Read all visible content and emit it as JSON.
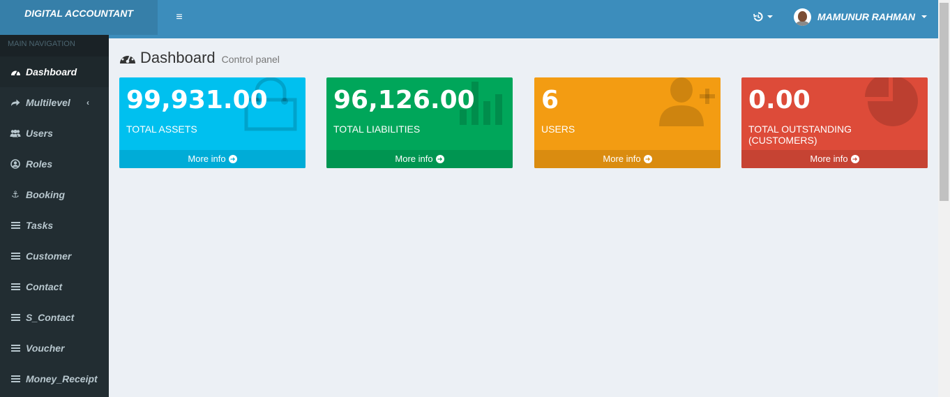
{
  "app": {
    "title": "DIGITAL ACCOUNTANT"
  },
  "header": {
    "menu_icon": "hamburger-icon",
    "history_icon": "history-icon",
    "user_name": "MAMUNUR RAHMAN"
  },
  "sidebar": {
    "header": "MAIN NAVIGATION",
    "items": [
      {
        "label": "Dashboard",
        "icon": "dashboard-icon",
        "active": true
      },
      {
        "label": "Multilevel",
        "icon": "share-icon"
      },
      {
        "label": "Users",
        "icon": "users-icon"
      },
      {
        "label": "Roles",
        "icon": "user-circle-icon"
      },
      {
        "label": "Booking",
        "icon": "anchor-icon"
      },
      {
        "label": "Tasks",
        "icon": "list-icon"
      },
      {
        "label": "Customer",
        "icon": "list-icon"
      },
      {
        "label": "Contact",
        "icon": "list-icon"
      },
      {
        "label": "S_Contact",
        "icon": "list-icon"
      },
      {
        "label": "Voucher",
        "icon": "list-icon"
      },
      {
        "label": "Money_Receipt",
        "icon": "list-icon"
      }
    ]
  },
  "page": {
    "title": "Dashboard",
    "subtitle": "Control panel"
  },
  "boxes": [
    {
      "value": "99,931.00",
      "label": "TOTAL ASSETS",
      "footer": "More info",
      "color": "#00c0ef",
      "icon": "shopping-bag-icon"
    },
    {
      "value": "96,126.00",
      "label": "TOTAL LIABILITIES",
      "footer": "More info",
      "color": "#00a65a",
      "icon": "bar-chart-icon"
    },
    {
      "value": "6",
      "label": "USERS",
      "footer": "More info",
      "color": "#f39c12",
      "icon": "user-plus-icon"
    },
    {
      "value": "0.00",
      "label": "TOTAL OUTSTANDING (CUSTOMERS)",
      "footer": "More info",
      "color": "#dd4b39",
      "icon": "pie-chart-icon"
    }
  ]
}
